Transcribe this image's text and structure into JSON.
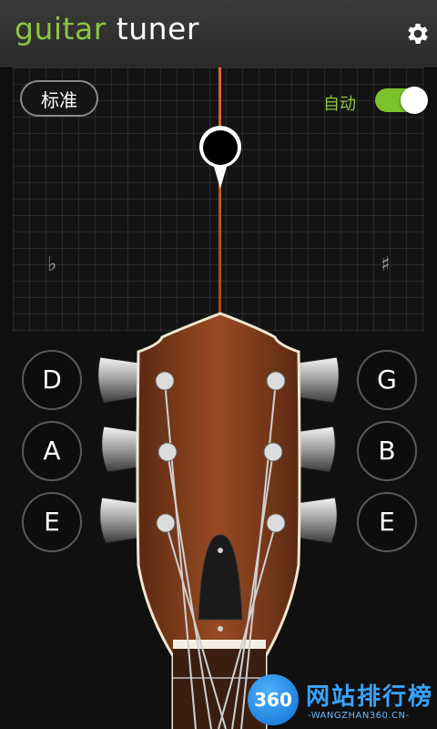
{
  "app": {
    "title_part1": "guitar",
    "title_part2": "tuner",
    "accent": "#8dc63f"
  },
  "tuner": {
    "mode_label": "标准",
    "auto_label": "自动",
    "auto_enabled": true,
    "flat_symbol": "♭",
    "sharp_symbol": "♯"
  },
  "strings": {
    "left": [
      "D",
      "A",
      "E"
    ],
    "right": [
      "G",
      "B",
      "E"
    ]
  },
  "watermark": {
    "logo": "360",
    "text": "网站排行榜",
    "sub": "-WANGZHAN360.CN-"
  },
  "icons": {
    "settings": "gear-icon"
  }
}
